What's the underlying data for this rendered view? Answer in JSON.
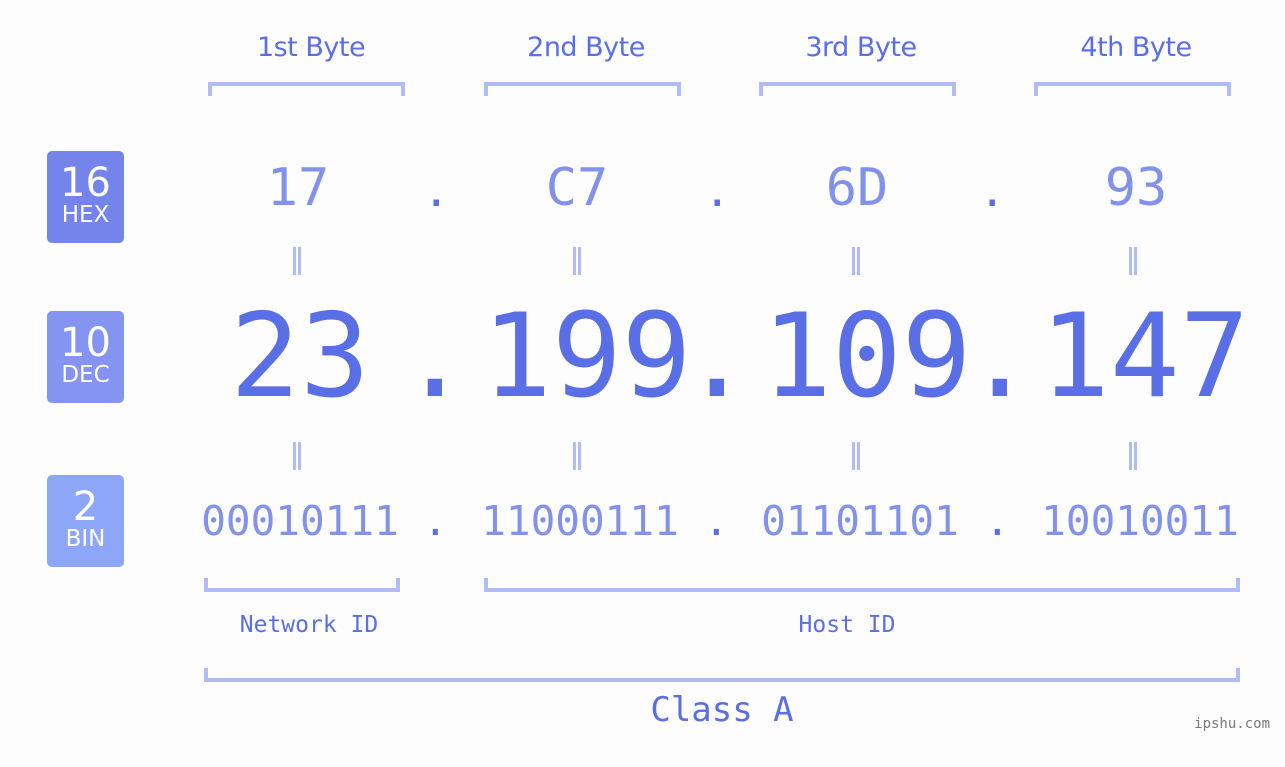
{
  "bytes": [
    {
      "header": "1st Byte",
      "hex": "17",
      "dec": "23",
      "bin": "00010111"
    },
    {
      "header": "2nd Byte",
      "hex": "C7",
      "dec": "199",
      "bin": "11000111"
    },
    {
      "header": "3rd Byte",
      "hex": "6D",
      "dec": "109",
      "bin": "01101101"
    },
    {
      "header": "4th Byte",
      "hex": "93",
      "dec": "147",
      "bin": "10010011"
    }
  ],
  "separator": ".",
  "equals_mark": "=",
  "badges": {
    "hex": {
      "number": "16",
      "label": "HEX",
      "color": "#7484ea"
    },
    "dec": {
      "number": "10",
      "label": "DEC",
      "color": "#8494f0"
    },
    "bin": {
      "number": "2",
      "label": "BIN",
      "color": "#8ea6f8"
    }
  },
  "segments": {
    "network": "Network ID",
    "host": "Host ID"
  },
  "ip_class": "Class A",
  "watermark": "ipshu.com",
  "colors": {
    "accent": "#5a6ee6",
    "secondary": "#8291ec",
    "bracket": "#b1bcf7",
    "background": "#fcfdfc"
  }
}
